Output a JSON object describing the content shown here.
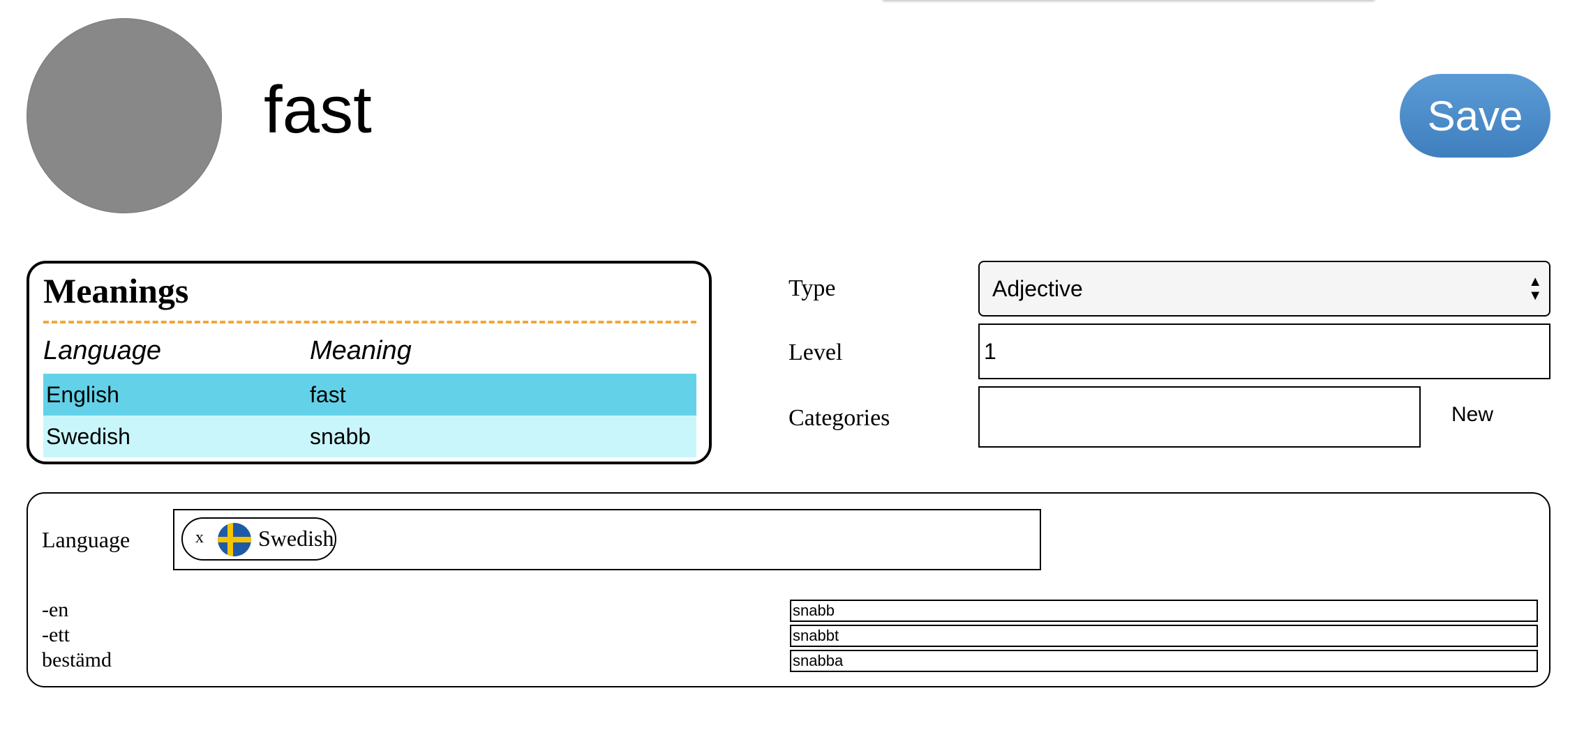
{
  "header": {
    "word": "fast",
    "save_label": "Save"
  },
  "meanings": {
    "title": "Meanings",
    "columns": [
      "Language",
      "Meaning"
    ],
    "rows": [
      {
        "language": "English",
        "meaning": "fast"
      },
      {
        "language": "Swedish",
        "meaning": "snabb"
      }
    ]
  },
  "fields": {
    "type_label": "Type",
    "type_value": "Adjective",
    "level_label": "Level",
    "level_value": "1",
    "categories_label": "Categories",
    "categories_value": "",
    "new_label": "New"
  },
  "language_section": {
    "label": "Language",
    "chip_remove": "x",
    "chip_icon": "sweden-flag-icon",
    "selected": "Swedish",
    "forms": [
      {
        "label": "-en",
        "value": "snabb"
      },
      {
        "label": "-ett",
        "value": "snabbt"
      },
      {
        "label": "bestämd",
        "value": "snabba"
      }
    ]
  },
  "colors": {
    "save_button": "#4a8ac9",
    "row_highlight": "#63d2e8",
    "row_light": "#c9f6fb",
    "dash_accent": "#f4a733",
    "avatar": "#888888"
  }
}
